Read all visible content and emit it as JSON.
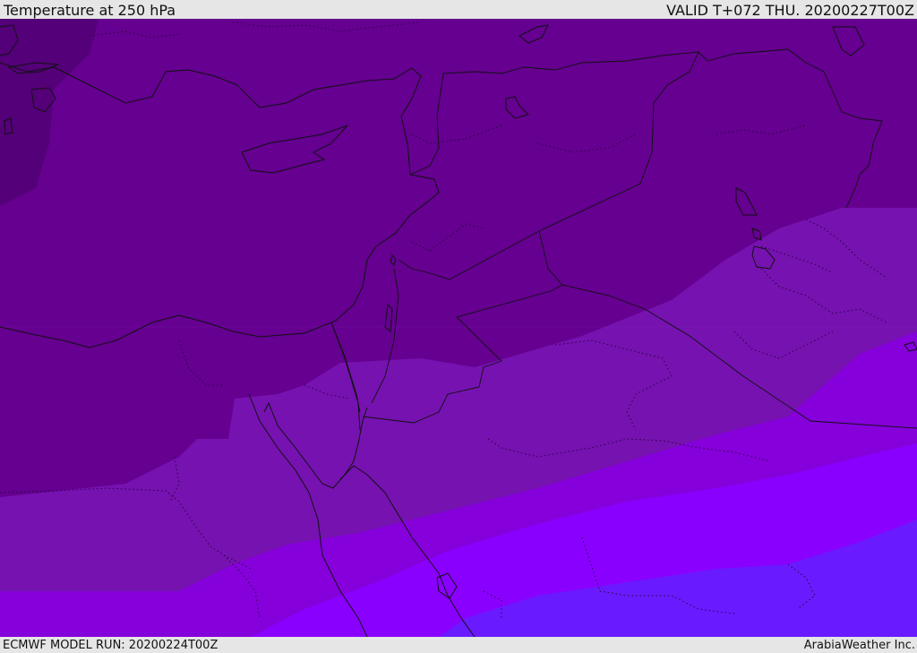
{
  "header": {
    "title": "Temperature at 250 hPa",
    "valid_time": "VALID T+072 THU. 20200227T00Z"
  },
  "footer": {
    "model_run": "ECMWF MODEL RUN: 20200224T00Z",
    "credit": "ArabiaWeather Inc."
  },
  "map": {
    "variable": "temperature",
    "level": "250 hPa",
    "colors": {
      "band_darkest": "#540078",
      "band_1": "#650090",
      "band_2": "#7612b0",
      "band_3": "#8500da",
      "band_4": "#8a00ff",
      "band_5": "#6a1aff",
      "coastline": "#111111",
      "border": "#111111"
    }
  }
}
